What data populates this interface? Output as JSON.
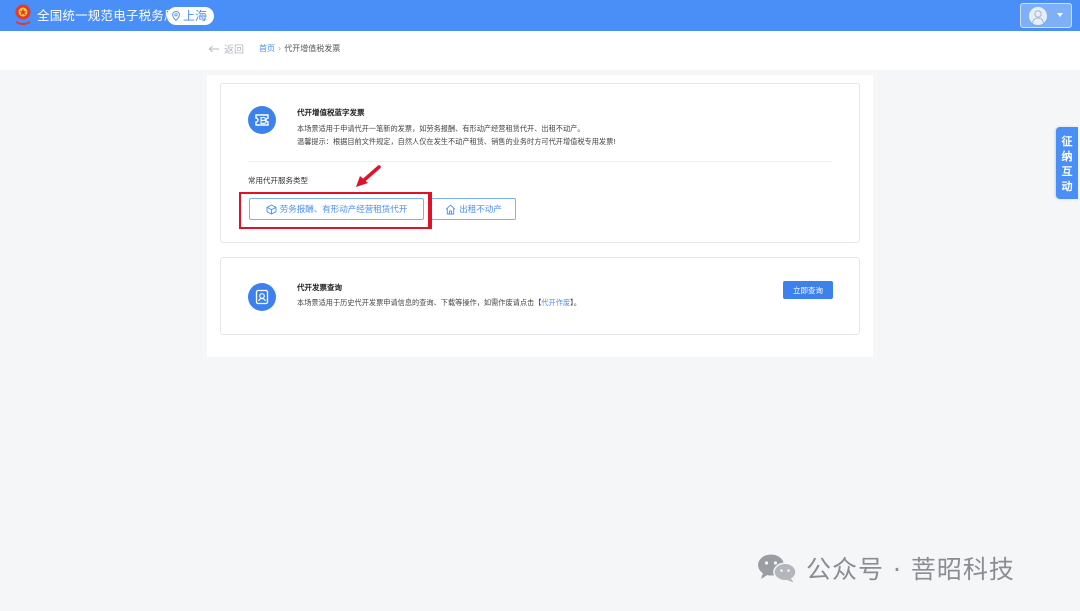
{
  "header": {
    "site_title": "全国统一规范电子税务局",
    "city": "上海",
    "icons": {
      "emblem": "tax-emblem",
      "location": "location-pin-icon",
      "avatar": "user-avatar-icon",
      "caret": "caret-down-icon"
    }
  },
  "breadcrumb": {
    "back_label": "返回",
    "items": [
      "首页",
      "代开增值税发票"
    ],
    "separator": "›"
  },
  "card_blue_invoice": {
    "icon": "invoice-ticket-icon",
    "title": "代开增值税蓝字发票",
    "desc_line1": "本场景适用于申请代开一笔新的发票，如劳务报酬、有形动产经营租赁代开、出租不动产。",
    "desc_line2": "温馨提示：根据目前文件规定，自然人仅在发生不动产租赁、销售的业务时方可代开增值税专用发票!",
    "section_label": "常用代开服务类型",
    "services": [
      {
        "label": "劳务报酬、有形动产经营租赁代开",
        "icon": "cube-icon"
      },
      {
        "label": "出租不动产",
        "icon": "house-icon"
      }
    ]
  },
  "card_query": {
    "icon": "search-document-icon",
    "title": "代开发票查询",
    "desc_before": "本场景适用于历史代开发票申请信息的查询、下载等操作，如需作废请点击【",
    "desc_link": "代开作废",
    "desc_after": "】。",
    "button_label": "立即查询"
  },
  "side_tab": {
    "chars": [
      "征",
      "纳",
      "互",
      "动"
    ]
  },
  "watermark": {
    "text": "公众号 · 菩昭科技",
    "icon": "wechat-icon"
  },
  "colors": {
    "brand_blue": "#4a8ff7",
    "button_blue": "#3d82ec",
    "highlight_red": "#e0122a"
  }
}
